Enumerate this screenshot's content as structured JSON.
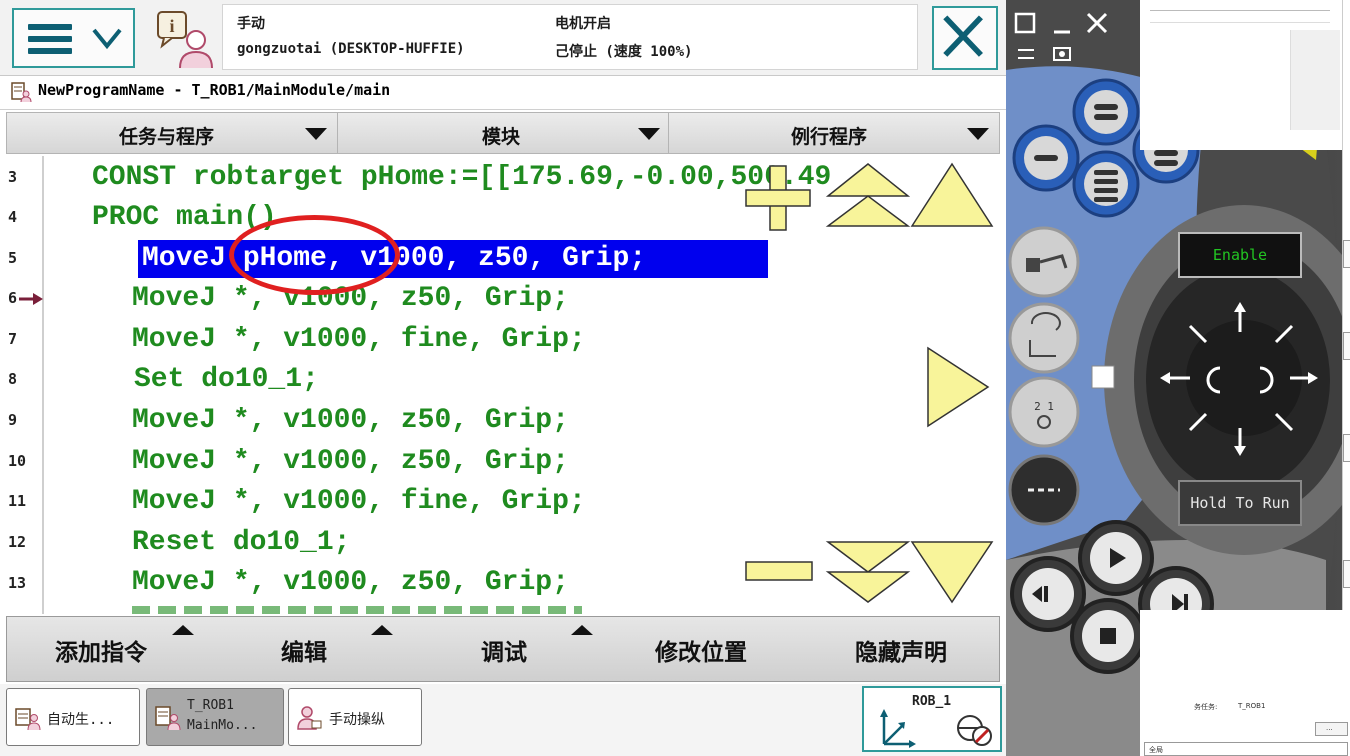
{
  "header": {
    "mode": "手动",
    "station": "gongzuotai (DESKTOP-HUFFIE)",
    "motor": "电机开启",
    "state": "己停止 (速度 100%)"
  },
  "path": "NewProgramName - T_ROB1/MainModule/main",
  "tabs": [
    "任务与程序",
    "模块",
    "例行程序"
  ],
  "code": {
    "lines": [
      {
        "n": "3",
        "text": "CONST robtarget pHome:=[[175.69,-0.00,506.49"
      },
      {
        "n": "4",
        "text": "PROC main()"
      },
      {
        "n": "5",
        "text": "MoveJ pHome, v1000, z50, Grip;"
      },
      {
        "n": "6",
        "text": "MoveJ *, v1000, z50, Grip;"
      },
      {
        "n": "7",
        "text": "MoveJ *, v1000, fine, Grip;"
      },
      {
        "n": "8",
        "text": "Set do10_1;"
      },
      {
        "n": "9",
        "text": "MoveJ *, v1000, z50, Grip;"
      },
      {
        "n": "10",
        "text": "MoveJ *, v1000, z50, Grip;"
      },
      {
        "n": "11",
        "text": "MoveJ *, v1000, fine, Grip;"
      },
      {
        "n": "12",
        "text": "Reset do10_1;"
      },
      {
        "n": "13",
        "text": "MoveJ *, v1000, z50, Grip;"
      }
    ]
  },
  "commands": [
    "添加指令",
    "编辑",
    "调试",
    "修改位置",
    "隐藏声明"
  ],
  "taskbar": {
    "auto": "自动生...",
    "prog_line1": "T_ROB1",
    "prog_line2": "MainMo...",
    "jog": "手动操纵",
    "robot": "ROB_1"
  },
  "pendant": {
    "enable": "Enable",
    "hold": "Hold To Run"
  },
  "bgwin": {
    "task_label": "务任务:",
    "task_value": "T_ROB1",
    "global": "全局",
    "ellipsis": "..."
  },
  "colors": {
    "code_green": "#1f8b1f",
    "selection_blue": "#0000ee",
    "annotation_red": "#e02020",
    "frame_teal": "#2f9a9a"
  }
}
